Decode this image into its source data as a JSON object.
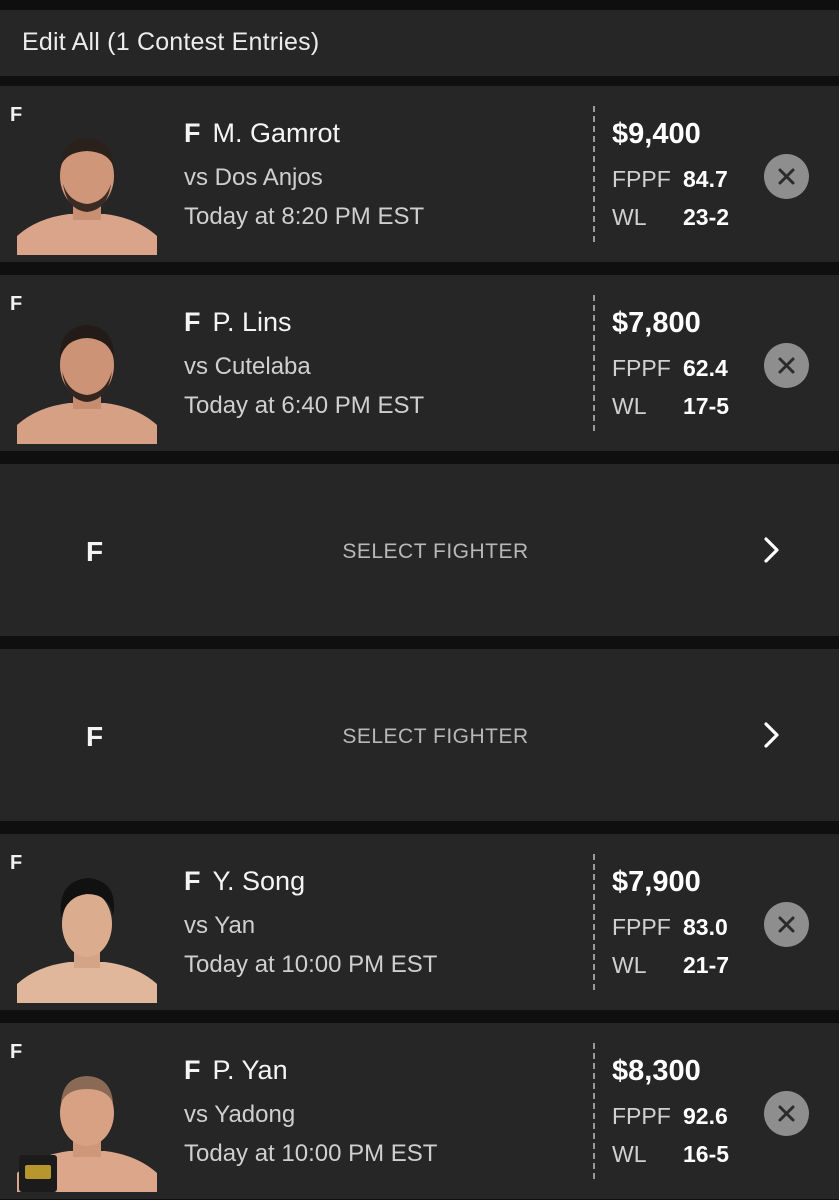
{
  "header": {
    "title": "Edit All (1 Contest Entries)"
  },
  "entries": [
    {
      "corner_position": "F",
      "position": "F",
      "name": "M. Gamrot",
      "opponent": "vs Dos Anjos",
      "time": "Today at 8:20 PM EST",
      "salary": "$9,400",
      "fppf_label": "FPPF",
      "fppf": "84.7",
      "wl_label": "WL",
      "wl": "23-2"
    },
    {
      "corner_position": "F",
      "position": "F",
      "name": "P. Lins",
      "opponent": "vs Cutelaba",
      "time": "Today at 6:40 PM EST",
      "salary": "$7,800",
      "fppf_label": "FPPF",
      "fppf": "62.4",
      "wl_label": "WL",
      "wl": "17-5"
    },
    {
      "corner_position": "F",
      "position": "F",
      "name": "Y. Song",
      "opponent": "vs Yan",
      "time": "Today at 10:00 PM EST",
      "salary": "$7,900",
      "fppf_label": "FPPF",
      "fppf": "83.0",
      "wl_label": "WL",
      "wl": "21-7"
    },
    {
      "corner_position": "F",
      "position": "F",
      "name": "P. Yan",
      "opponent": "vs Yadong",
      "time": "Today at 10:00 PM EST",
      "salary": "$8,300",
      "fppf_label": "FPPF",
      "fppf": "92.6",
      "wl_label": "WL",
      "wl": "16-5"
    }
  ],
  "empty_slots": [
    {
      "position": "F",
      "label": "SELECT FIGHTER"
    },
    {
      "position": "F",
      "label": "SELECT FIGHTER"
    }
  ],
  "icons": {
    "remove": "close-circle-icon",
    "chevron": "chevron-right-icon",
    "photo": "fighter-photo"
  },
  "colors": {
    "background": "#0f0f0f",
    "card": "#262626",
    "remove_button": "#8e8e8e"
  }
}
